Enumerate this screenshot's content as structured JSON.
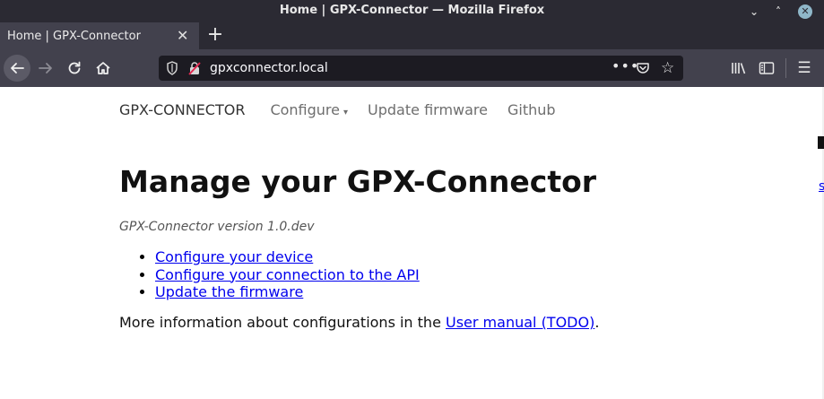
{
  "window": {
    "title": "Home | GPX-Connector — Mozilla Firefox",
    "minimize_glyph": "⌄",
    "maximize_glyph": "˄",
    "close_glyph": "✕"
  },
  "tabs": [
    {
      "label": "Home | GPX-Connector",
      "close_glyph": "✕",
      "active": true
    }
  ],
  "newtab_glyph": "+",
  "navbar": {
    "url": "gpxconnector.local",
    "page_actions_glyph": "•••",
    "star_glyph": "☆",
    "menu_glyph": "☰"
  },
  "site": {
    "brand": "GPX-CONNECTOR",
    "nav": {
      "configure": "Configure",
      "configure_caret": "▾",
      "update_firmware": "Update firmware",
      "github": "Github"
    },
    "heading": "Manage your GPX-Connector",
    "version": "GPX-Connector version 1.0.dev",
    "links": [
      "Configure your device",
      "Configure your connection to the API",
      "Update the firmware"
    ],
    "info_prefix": "More information about configurations in the ",
    "info_link": "User manual (TODO)",
    "info_suffix": ".",
    "edge_char": "s"
  },
  "colors": {
    "chrome_dark": "#2b2a33",
    "toolbar": "#42414d",
    "urlbar": "#1c1b22",
    "link": "#0000ee"
  }
}
